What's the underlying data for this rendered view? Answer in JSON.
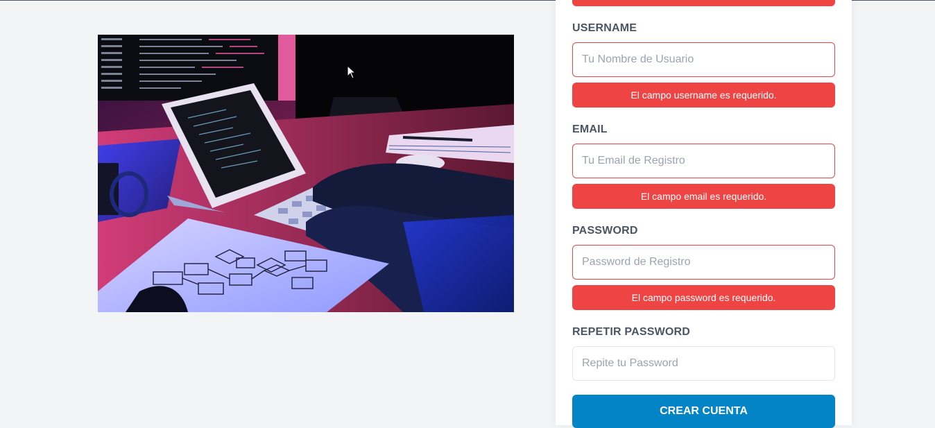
{
  "form": {
    "fields": [
      {
        "label": "USERNAME",
        "placeholder": "Tu Nombre de Usuario",
        "error": "El campo username es requerido."
      },
      {
        "label": "EMAIL",
        "placeholder": "Tu Email de Registro",
        "error": "El campo email es requerido."
      },
      {
        "label": "PASSWORD",
        "placeholder": "Password de Registro",
        "error": "El campo password es requerido."
      },
      {
        "label": "REPETIR PASSWORD",
        "placeholder": "Repite tu Password"
      }
    ],
    "submit_label": "CREAR CUENTA"
  },
  "colors": {
    "error": "#ef4444",
    "submit": "#0284c7",
    "background": "#f3f4f6",
    "label": "#4b5563"
  },
  "icons": {
    "cursor": "mouse-pointer-icon"
  }
}
